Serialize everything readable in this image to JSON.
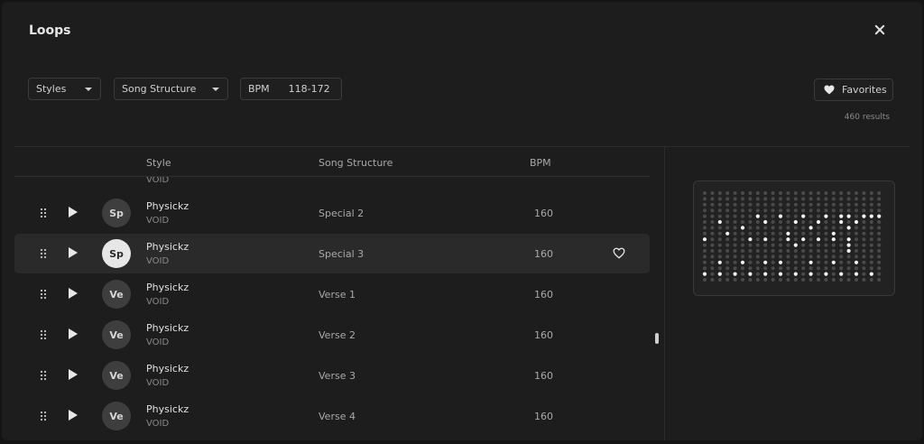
{
  "dialog": {
    "title": "Loops"
  },
  "filters": {
    "styles_label": "Styles",
    "song_structure_label": "Song Structure",
    "bpm_label": "BPM",
    "bpm_range": "118-172"
  },
  "favorites_label": "Favorites",
  "results_count": "460 results",
  "columns": {
    "style": "Style",
    "song_structure": "Song Structure",
    "bpm": "BPM"
  },
  "rows": [
    {
      "initials": "Sp",
      "name": "Physickz",
      "sub": "VOID",
      "structure": "Special 2",
      "bpm": "160",
      "selected": false
    },
    {
      "initials": "Sp",
      "name": "Physickz",
      "sub": "VOID",
      "structure": "Special 3",
      "bpm": "160",
      "selected": true
    },
    {
      "initials": "Ve",
      "name": "Physickz",
      "sub": "VOID",
      "structure": "Verse 1",
      "bpm": "160",
      "selected": false
    },
    {
      "initials": "Ve",
      "name": "Physickz",
      "sub": "VOID",
      "structure": "Verse 2",
      "bpm": "160",
      "selected": false
    },
    {
      "initials": "Ve",
      "name": "Physickz",
      "sub": "VOID",
      "structure": "Verse 3",
      "bpm": "160",
      "selected": false
    },
    {
      "initials": "Ve",
      "name": "Physickz",
      "sub": "VOID",
      "structure": "Verse 4",
      "bpm": "160",
      "selected": false
    }
  ],
  "partial_row": {
    "sub": "VOID"
  },
  "pattern": {
    "rows": 16,
    "cols": 24,
    "active": [
      [
        4,
        7
      ],
      [
        4,
        10
      ],
      [
        4,
        13
      ],
      [
        4,
        16
      ],
      [
        4,
        18
      ],
      [
        4,
        19
      ],
      [
        4,
        21
      ],
      [
        4,
        22
      ],
      [
        4,
        23
      ],
      [
        5,
        2
      ],
      [
        5,
        8
      ],
      [
        5,
        12
      ],
      [
        5,
        15
      ],
      [
        5,
        18
      ],
      [
        5,
        20
      ],
      [
        6,
        5
      ],
      [
        6,
        14
      ],
      [
        6,
        19
      ],
      [
        7,
        3
      ],
      [
        7,
        11
      ],
      [
        7,
        17
      ],
      [
        8,
        0
      ],
      [
        8,
        6
      ],
      [
        8,
        8
      ],
      [
        8,
        11
      ],
      [
        8,
        13
      ],
      [
        8,
        15
      ],
      [
        8,
        17
      ],
      [
        8,
        19
      ],
      [
        9,
        12
      ],
      [
        9,
        19
      ],
      [
        10,
        19
      ],
      [
        12,
        2
      ],
      [
        12,
        5
      ],
      [
        12,
        8
      ],
      [
        12,
        10
      ],
      [
        12,
        14
      ],
      [
        12,
        17
      ],
      [
        12,
        20
      ],
      [
        14,
        0
      ],
      [
        14,
        2
      ],
      [
        14,
        4
      ],
      [
        14,
        6
      ],
      [
        14,
        8
      ],
      [
        14,
        10
      ],
      [
        14,
        12
      ],
      [
        14,
        14
      ],
      [
        14,
        16
      ],
      [
        14,
        18
      ],
      [
        14,
        20
      ],
      [
        14,
        22
      ]
    ],
    "colors": {
      "on": "#f2f2f2",
      "off": "#4a4a4a"
    }
  }
}
